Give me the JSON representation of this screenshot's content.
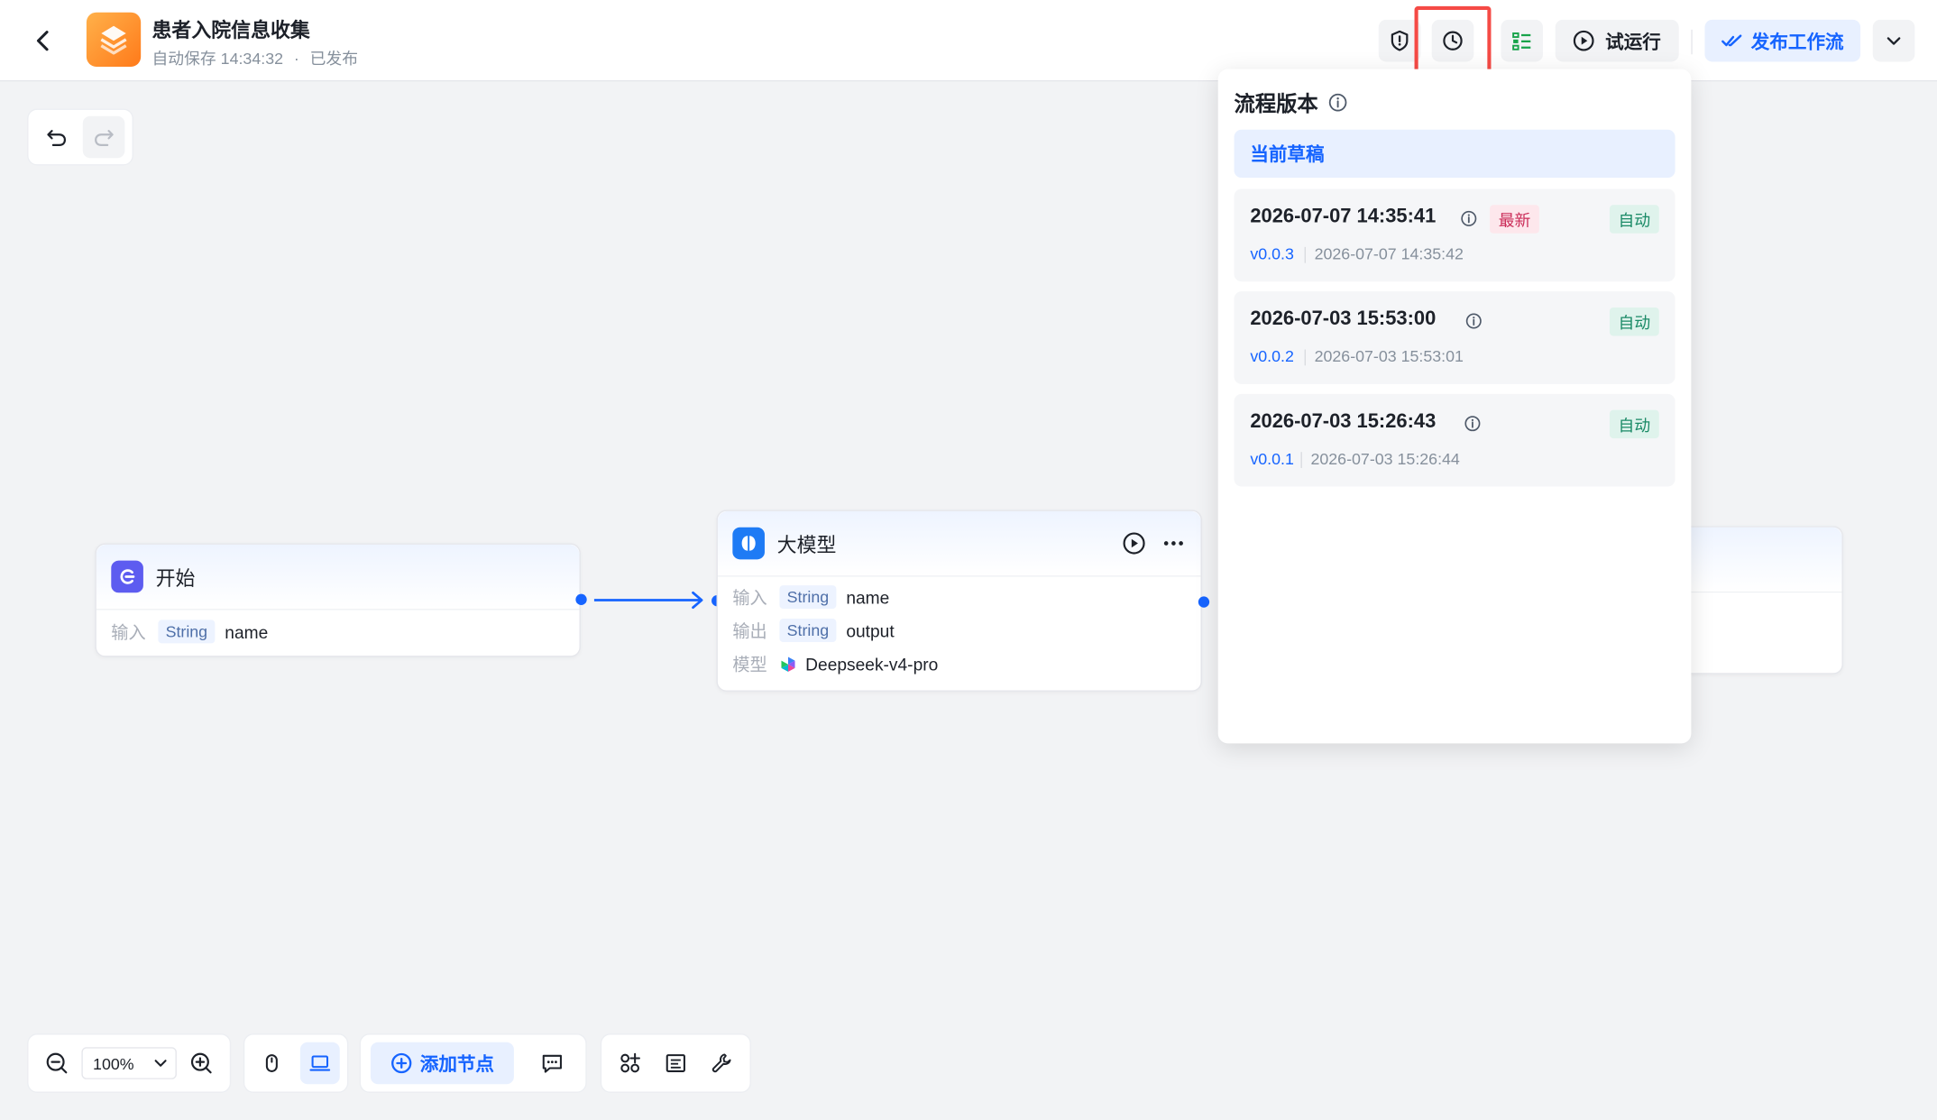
{
  "header": {
    "title": "患者入院信息收集",
    "autosave": "自动保存 14:34:32",
    "dot": "·",
    "status": "已发布",
    "run_label": "试运行",
    "publish_label": "发布工作流"
  },
  "nodes": {
    "start": {
      "title": "开始",
      "input_label": "输入",
      "input_type": "String",
      "input_name": "name"
    },
    "llm": {
      "title": "大模型",
      "input_label": "输入",
      "input_type": "String",
      "input_name": "name",
      "output_label": "输出",
      "output_type": "String",
      "output_name": "output",
      "model_label": "模型",
      "model_name": "Deepseek-v4-pro"
    }
  },
  "versions": {
    "title": "流程版本",
    "draft_label": "当前草稿",
    "items": [
      {
        "time": "2026-07-07 14:35:41",
        "badge_new": "最新",
        "badge": "自动",
        "version": "v0.0.3",
        "date": "2026-07-07 14:35:42"
      },
      {
        "time": "2026-07-03 15:53:00",
        "badge": "自动",
        "version": "v0.0.2",
        "date": "2026-07-03 15:53:01"
      },
      {
        "time": "2026-07-03 15:26:43",
        "badge": "自动",
        "version": "v0.0.1",
        "date": "2026-07-03 15:26:44"
      }
    ]
  },
  "toolbar": {
    "zoom": "100%",
    "add_node_label": "添加节点"
  },
  "colors": {
    "accent": "#1664ff",
    "highlight": "#f54a45",
    "tag_new_bg": "#fde7ec",
    "tag_auto_bg": "#dff3ec"
  }
}
